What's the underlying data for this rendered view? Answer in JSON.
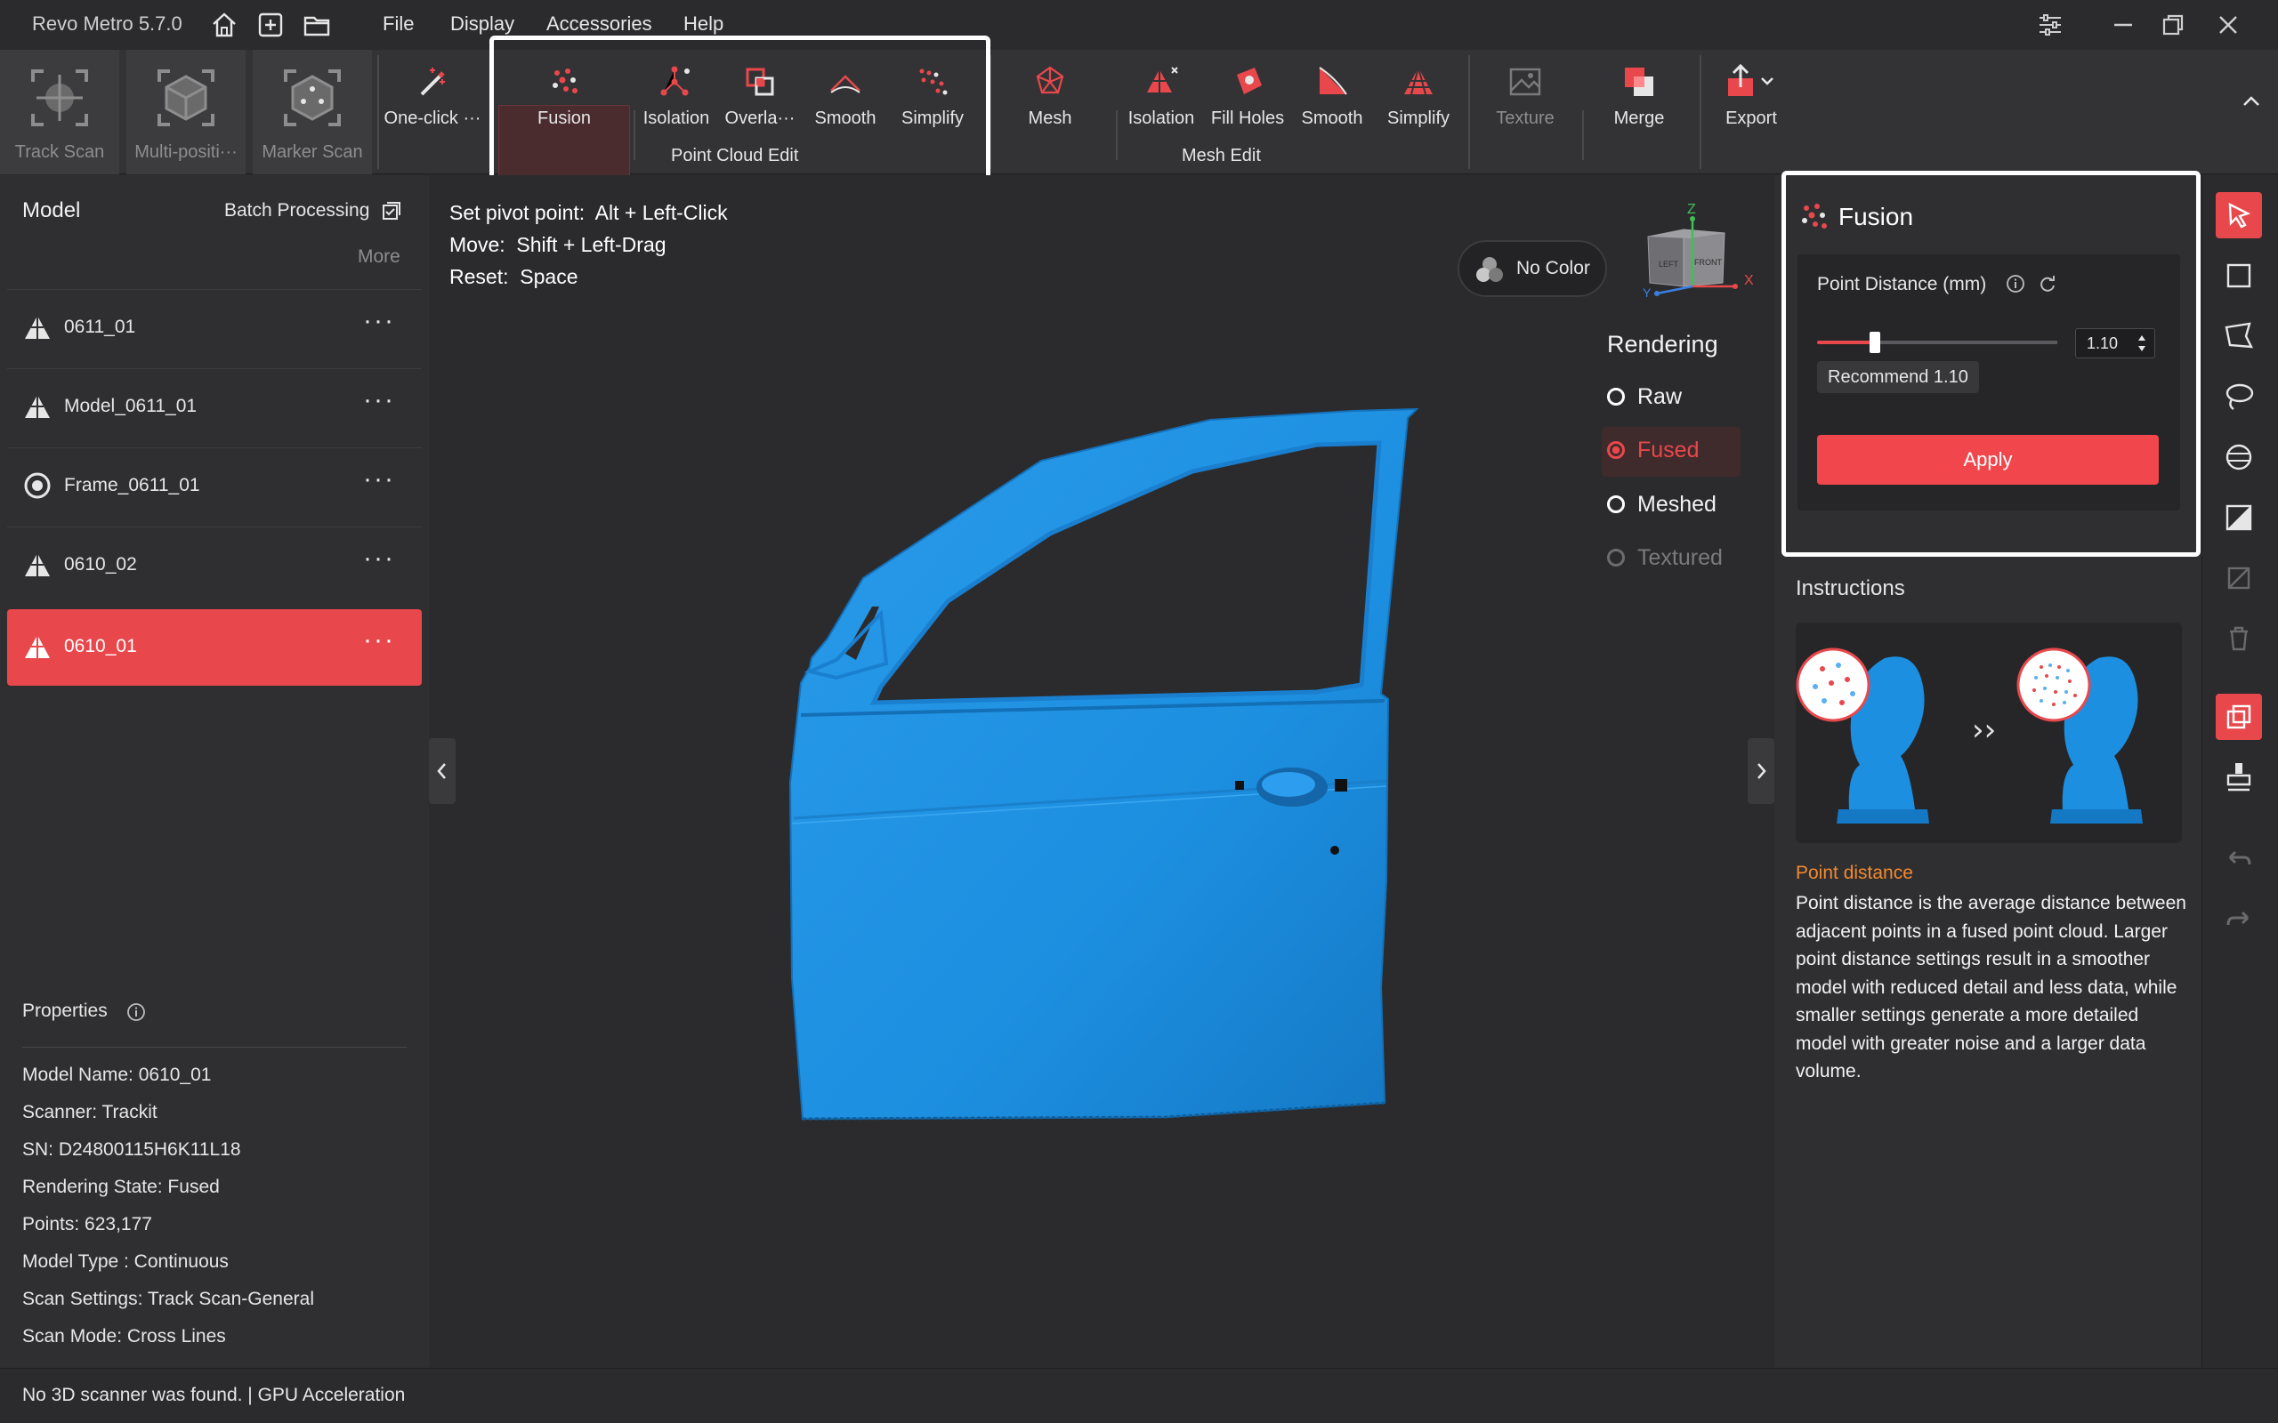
{
  "app": {
    "title": "Revo Metro 5.7.0"
  },
  "menu": {
    "items": [
      "File",
      "Display",
      "Accessories",
      "Help"
    ]
  },
  "toolbar": {
    "scan_tools": [
      {
        "label": "Track Scan",
        "icon": "track-scan-icon"
      },
      {
        "label": "Multi-positi···",
        "icon": "multi-position-scan-icon"
      },
      {
        "label": "Marker Scan",
        "icon": "marker-scan-icon"
      }
    ],
    "one_click": "One-click ···",
    "point_cloud_edit": {
      "group_label": "Point Cloud Edit",
      "tools": [
        "Fusion",
        "Isolation",
        "Overla···",
        "Smooth",
        "Simplify"
      ]
    },
    "mesh": "Mesh",
    "mesh_edit": {
      "group_label": "Mesh Edit",
      "tools": [
        "Isolation",
        "Fill Holes",
        "Smooth",
        "Simplify"
      ]
    },
    "texture": "Texture",
    "merge": "Merge",
    "export": "Export"
  },
  "left_panel": {
    "title": "Model",
    "batch_processing": "Batch Processing",
    "more": "More",
    "models": [
      {
        "name": "0611_01",
        "icon": "point-cloud-icon",
        "selected": false
      },
      {
        "name": "Model_0611_01",
        "icon": "point-cloud-icon",
        "selected": false
      },
      {
        "name": "Frame_0611_01",
        "icon": "frame-target-icon",
        "selected": false
      },
      {
        "name": "0610_02",
        "icon": "point-cloud-icon",
        "selected": false
      },
      {
        "name": "0610_01",
        "icon": "point-cloud-icon",
        "selected": true
      }
    ],
    "row_menu": "···",
    "properties": {
      "title": "Properties",
      "rows": [
        "Model Name:  0610_01",
        "Scanner:  Trackit",
        "SN:  D24800115H6K11L18",
        "Rendering State:  Fused",
        "Points:  623,177",
        "Model Type :  Continuous",
        "Scan Settings:  Track Scan-General",
        "Scan Mode:  Cross Lines"
      ]
    }
  },
  "viewport": {
    "hints": [
      {
        "key": "Set pivot point:",
        "value": "Alt + Left-Click"
      },
      {
        "key": "Move:",
        "value": "Shift + Left-Drag"
      },
      {
        "key": "Reset:",
        "value": "Space"
      }
    ],
    "color_mode": "No Color",
    "view_cube": {
      "z": "Z",
      "x": "X",
      "y": "Y",
      "left": "LEFT",
      "front": "FRONT"
    },
    "rendering": {
      "title": "Rendering",
      "options": [
        {
          "label": "Raw",
          "state": "normal"
        },
        {
          "label": "Fused",
          "state": "active"
        },
        {
          "label": "Meshed",
          "state": "normal"
        },
        {
          "label": "Textured",
          "state": "disabled"
        }
      ]
    },
    "model_color": "#1d8fe0"
  },
  "fusion_panel": {
    "title": "Fusion",
    "point_distance_label": "Point Distance (mm)",
    "value": "1.10",
    "slider_fraction": 0.24,
    "recommend": "Recommend 1.10",
    "apply": "Apply"
  },
  "instructions": {
    "title": "Instructions",
    "arrow": "››",
    "heading": "Point distance",
    "text": "Point distance is the average distance between adjacent points in a fused point cloud. Larger point distance settings result in a smoother model with reduced detail and less data, while smaller settings generate a more detailed model with greater noise and a larger data volume."
  },
  "status_bar": {
    "text": "No 3D scanner was found.  | GPU Acceleration"
  },
  "colors": {
    "accent": "#e8484c",
    "orange": "#f28a2e",
    "background": "#2b2b2d",
    "panel": "#2f2f31"
  }
}
